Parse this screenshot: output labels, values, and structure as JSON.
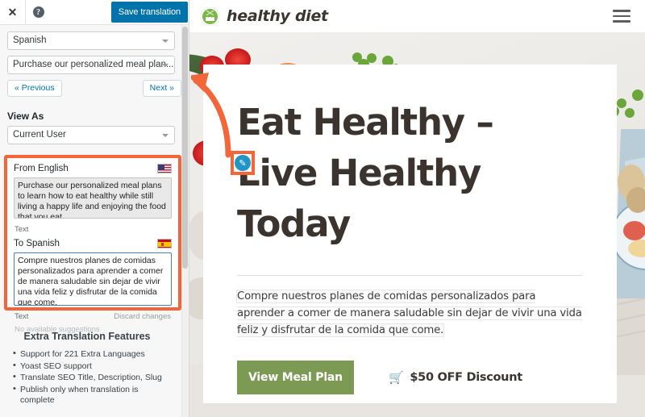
{
  "translator_panel": {
    "toolbar": {
      "close_label": "✕",
      "close_icon": "close-icon",
      "help_label": "?",
      "help_icon": "help-circle-icon",
      "save_label": "Save translation"
    },
    "language_select": {
      "value": "Spanish",
      "caret_icon": "chevron-down-icon"
    },
    "string_select": {
      "value": "Purchase our personalized meal plan...",
      "caret_icon": "chevron-down-icon"
    },
    "prev_label": "« Previous",
    "next_label": "Next »",
    "view_as_label": "View As",
    "view_as_select": {
      "value": "Current User",
      "caret_icon": "chevron-down-icon"
    },
    "from": {
      "heading": "From English",
      "flag_icon": "flag-us-icon",
      "text": "Purchase our personalized meal plans to learn how to eat healthy while still living a happy life and enjoying the food that you eat.",
      "meta_left": "Text"
    },
    "to": {
      "heading": "To Spanish",
      "flag_icon": "flag-es-icon",
      "text": "Compre nuestros planes de comidas personalizados para aprender a comer de manera saludable sin dejar de vivir una vida feliz y disfrutar de la comida que come.",
      "meta_left": "Text",
      "meta_right": "Discard changes",
      "suggestions": "No available suggestions"
    },
    "features": {
      "heading": "Extra Translation Features",
      "items": [
        "Support for 221 Extra Languages",
        "Yoast SEO support",
        "Translate SEO Title, Description, Slug",
        "Publish only when translation is complete"
      ]
    },
    "colors": {
      "save_button": "#0073aa",
      "highlight_border": "#f4663a",
      "focus_border": "#4a7fae"
    }
  },
  "site_preview": {
    "logo_icon": "leaf-circle-icon",
    "logo_text": "healthy diet",
    "menu_icon": "hamburger-menu-icon",
    "headline_line1": "Eat Healthy –",
    "headline_line2": "Live Healthy Today",
    "paragraph": "Compre nuestros planes de comidas personalizados para aprender a comer de manera saludable sin dejar de vivir una vida feliz y disfrutar de la comida que come.",
    "cta_label": "View Meal Plan",
    "discount_label": "$50 OFF Discount",
    "cart_icon": "shopping-cart-icon",
    "edit_pencil_icon": "pencil-edit-icon",
    "annotation_icon": "curved-arrow-icon",
    "colors": {
      "cta_green": "#7d9a55",
      "cart_red": "#d41616",
      "heading_dark": "#3b332e",
      "logo_green": "#7ab648"
    }
  }
}
